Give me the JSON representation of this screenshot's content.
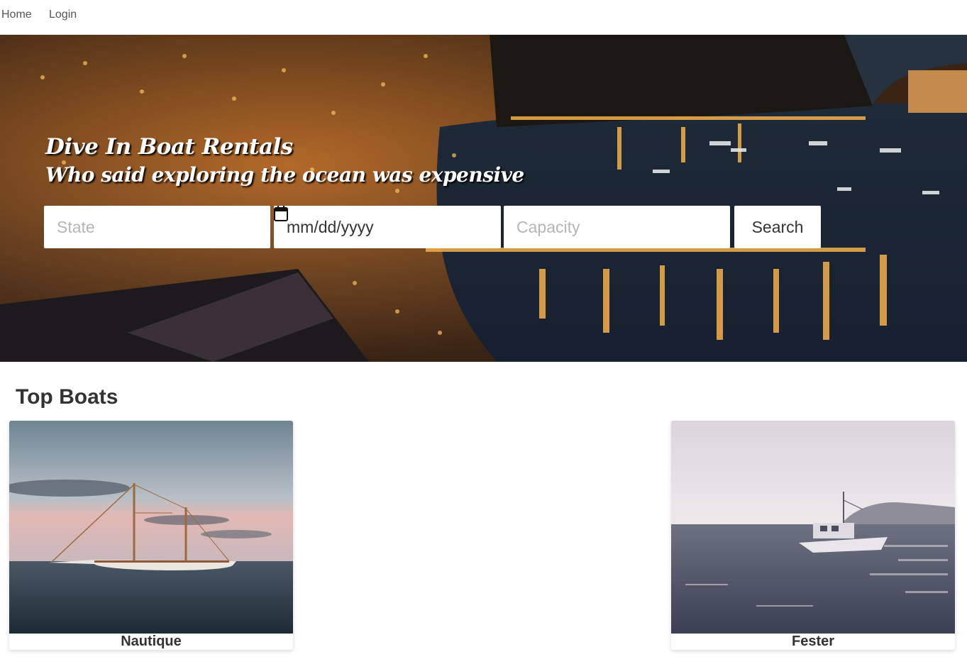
{
  "nav": {
    "items": [
      {
        "label": "Home"
      },
      {
        "label": "Login"
      }
    ]
  },
  "hero": {
    "title": "Dive In Boat Rentals",
    "subtitle": "Who said exploring the ocean was expensive"
  },
  "search": {
    "state_placeholder": "State",
    "date_value": "mm/dd/yyyy",
    "capacity_placeholder": "Capacity",
    "button_label": "Search"
  },
  "top_boats": {
    "heading": "Top Boats",
    "boats": [
      {
        "name": "Nautique"
      },
      {
        "name": "Fester"
      }
    ]
  },
  "colors": {
    "hero_lights": "#f2a23a",
    "text": "#333333",
    "placeholder": "#b5b5b5"
  }
}
